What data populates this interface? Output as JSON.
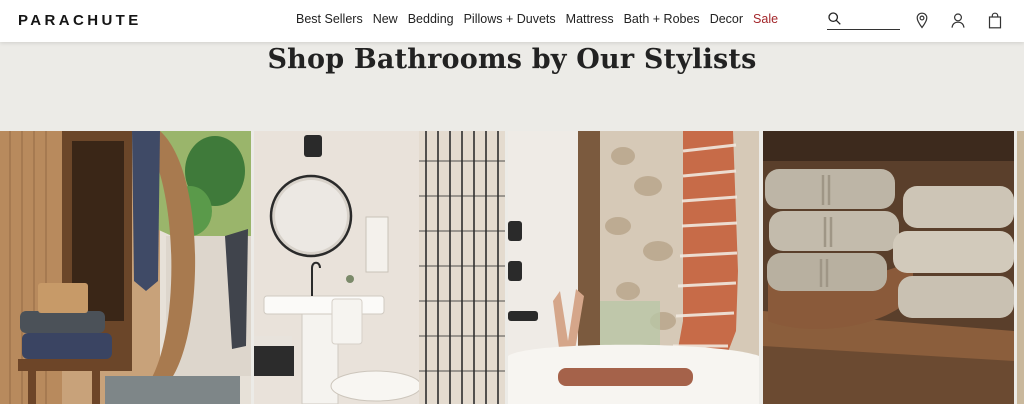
{
  "header": {
    "logo": "PARACHUTE",
    "nav": [
      {
        "label": "Best Sellers"
      },
      {
        "label": "New"
      },
      {
        "label": "Bedding"
      },
      {
        "label": "Pillows + Duvets"
      },
      {
        "label": "Mattress"
      },
      {
        "label": "Bath + Robes"
      },
      {
        "label": "Decor"
      },
      {
        "label": "Sale"
      }
    ],
    "search_value": "",
    "icons": [
      "search-icon",
      "location-pin-icon",
      "account-icon",
      "shopping-bag-icon"
    ]
  },
  "section": {
    "title": "Shop Bathrooms by Our Stylists"
  },
  "tiles": [
    "sauna-scene",
    "pedestal-sink-scene",
    "bathtub-scene",
    "towel-shelf-scene"
  ],
  "colors": {
    "sale": "#a3262a",
    "page_bg": "#ecebe7"
  }
}
